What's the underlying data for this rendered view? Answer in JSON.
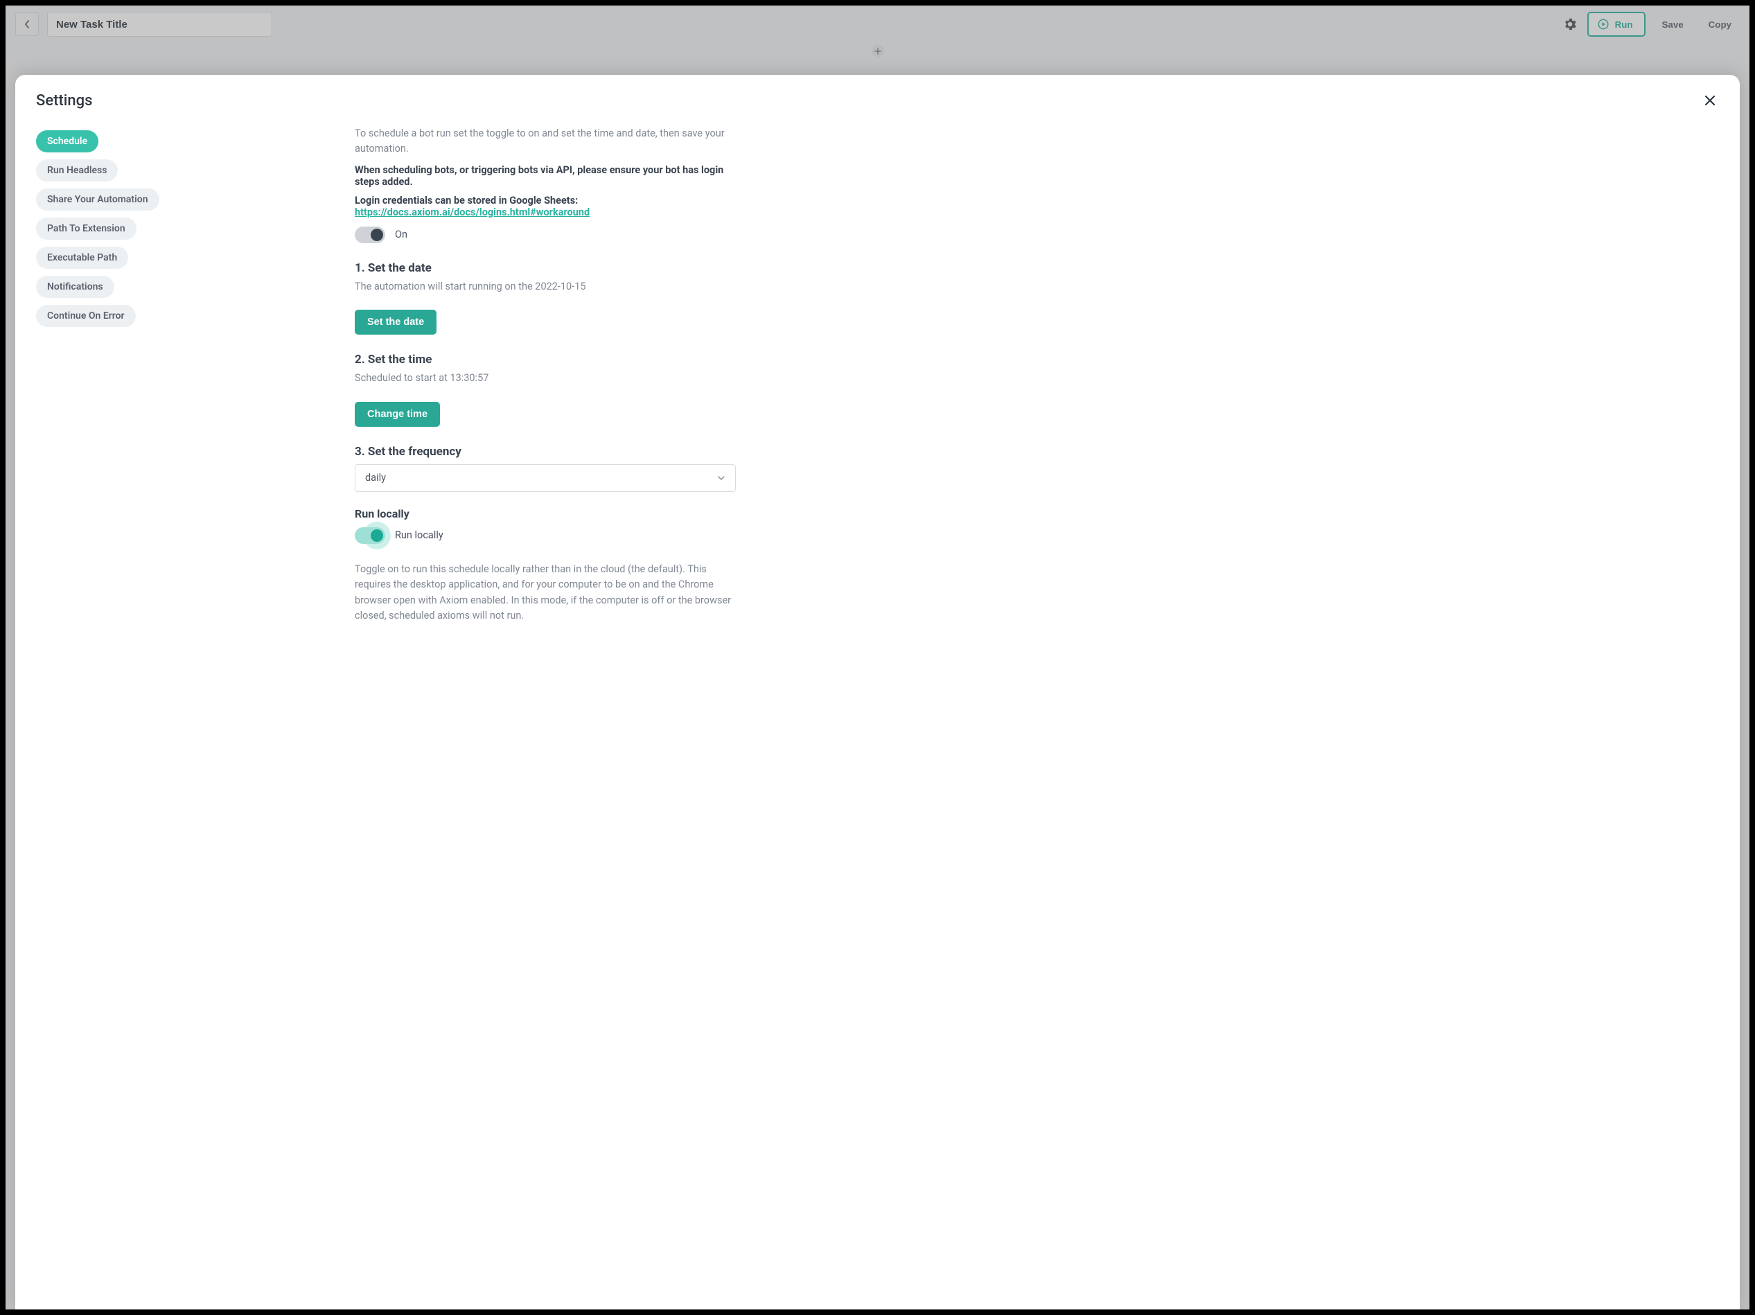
{
  "topbar": {
    "task_title": "New Task Title",
    "run_label": "Run",
    "save_label": "Save",
    "copy_label": "Copy"
  },
  "modal": {
    "title": "Settings"
  },
  "sidebar": {
    "items": [
      "Schedule",
      "Run Headless",
      "Share Your Automation",
      "Path To Extension",
      "Executable Path",
      "Notifications",
      "Continue On Error"
    ]
  },
  "schedule": {
    "intro": "To schedule a bot run set the toggle to on and set the time and date, then save your automation.",
    "warn": "When scheduling bots, or triggering bots via API, please ensure your bot has login steps added.",
    "creds_lead": "Login credentials can be stored in Google Sheets:",
    "creds_link": "https://docs.axiom.ai/docs/logins.html#workaround",
    "on_label": "On",
    "s1_title": "1. Set the date",
    "s1_text": "The automation will start running on the 2022-10-15",
    "s1_btn": "Set the date",
    "s2_title": "2. Set the time",
    "s2_text": "Scheduled to start at 13:30:57",
    "s2_btn": "Change time",
    "s3_title": "3. Set the frequency",
    "s3_value": "daily",
    "local_title": "Run locally",
    "local_label": "Run locally",
    "local_help": "Toggle on to run this schedule locally rather than in the cloud (the default). This requires the desktop application, and for your computer to be on and the Chrome browser open with Axiom enabled. In this mode, if the computer is off or the browser closed, scheduled axioms will not run."
  }
}
